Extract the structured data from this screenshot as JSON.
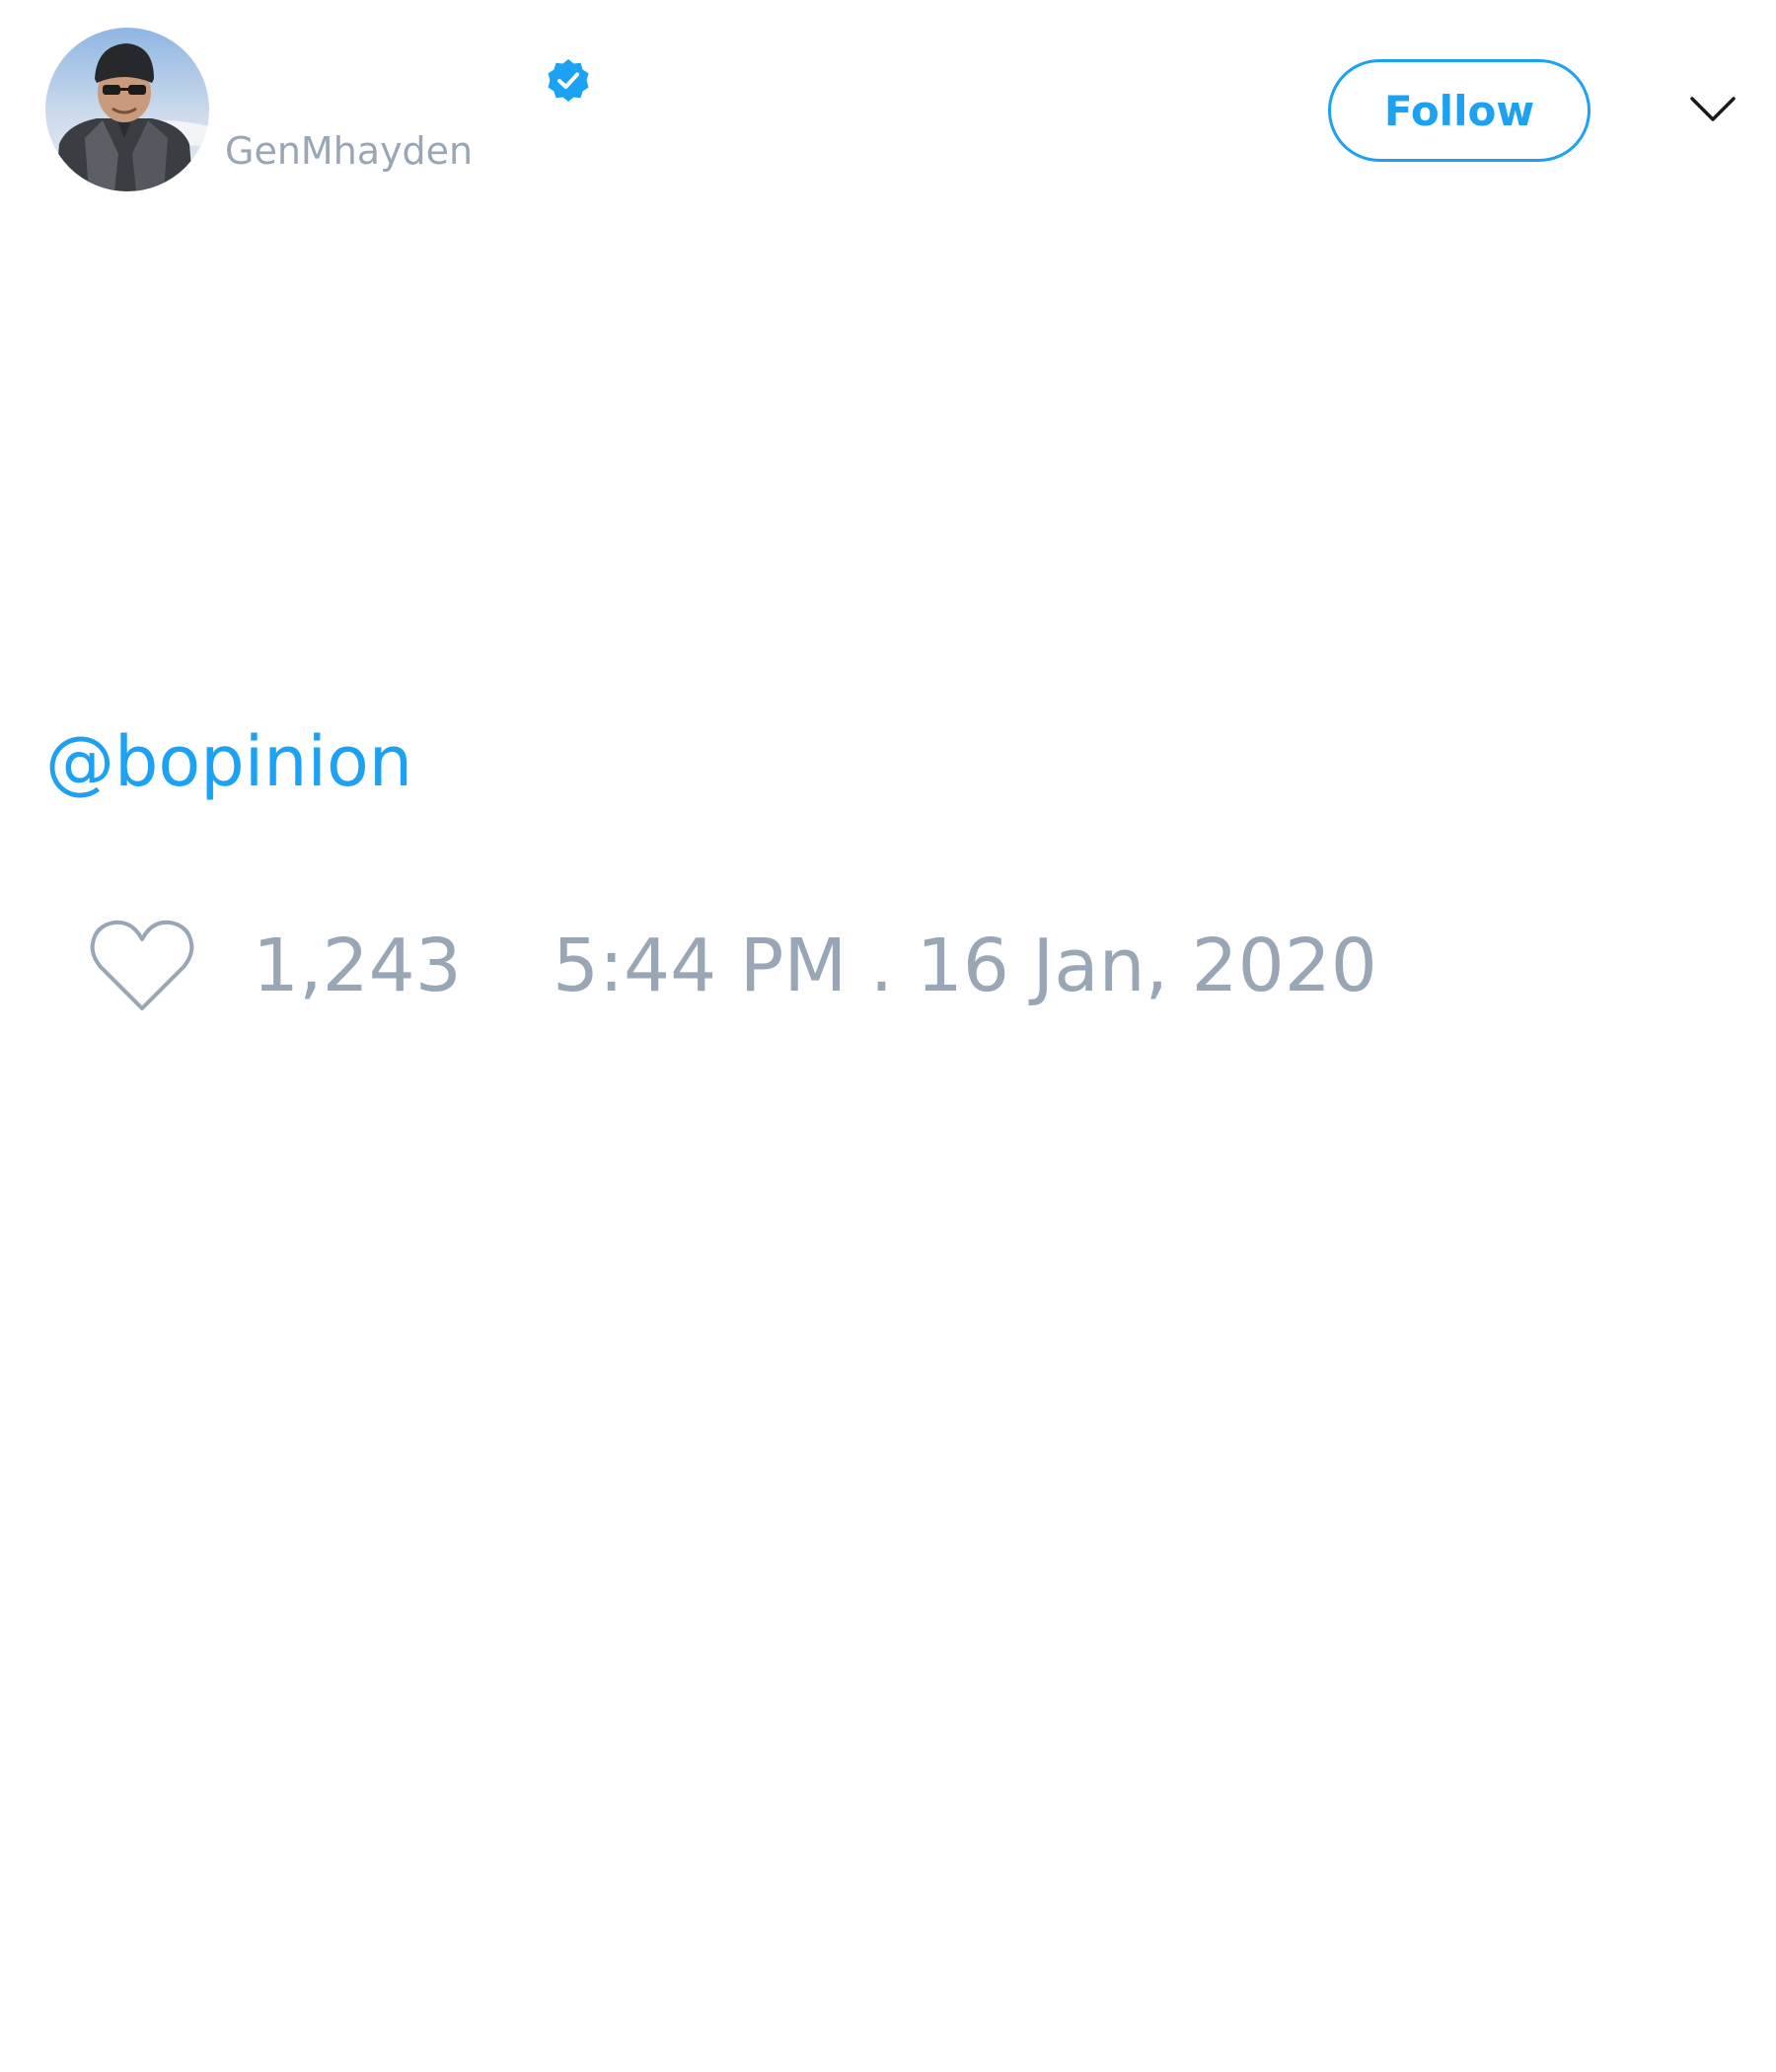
{
  "author": {
    "handle": "GenMhayden",
    "verified": true,
    "avatar": "avatar-photo"
  },
  "actions": {
    "follow_label": "Follow",
    "more_icon": "chevron-down-icon"
  },
  "tweet": {
    "mention": "@bopinion"
  },
  "footer": {
    "like_icon": "heart-icon",
    "like_count": "1,243",
    "timestamp": "5:44 PM . 16 Jan, 2020"
  },
  "colors": {
    "accent": "#1da1f2",
    "muted_text": "#98a6b5",
    "background": "#ffffff",
    "icon_dark": "#1a1a1a"
  }
}
